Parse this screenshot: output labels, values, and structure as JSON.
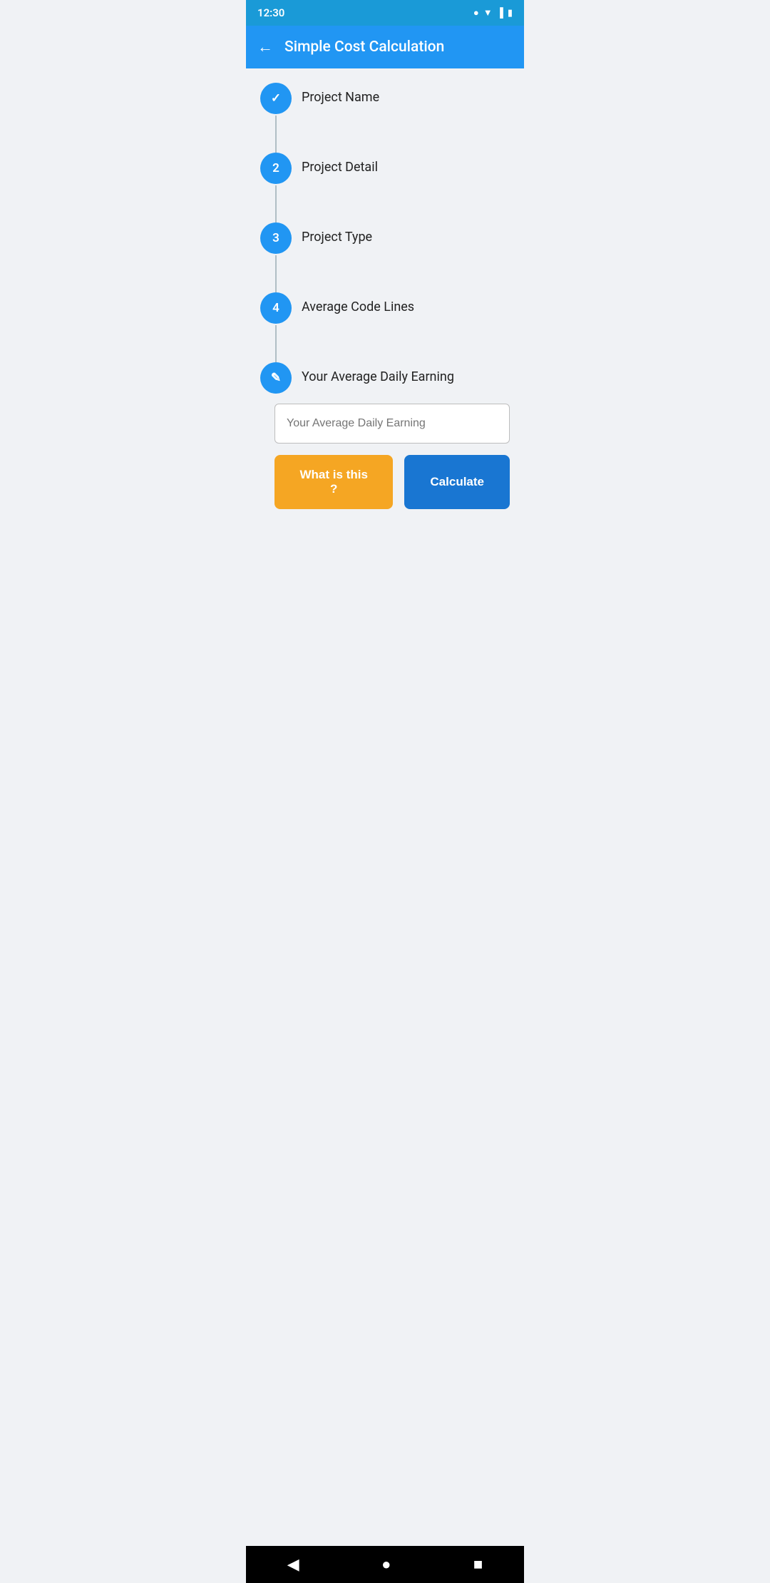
{
  "statusBar": {
    "time": "12:30",
    "icons": [
      "signal",
      "wifi",
      "battery"
    ]
  },
  "appBar": {
    "title": "Simple Cost Calculation",
    "backLabel": "←"
  },
  "steps": [
    {
      "id": "step-project-name",
      "number": "✓",
      "type": "completed",
      "label": "Project Name",
      "hasConnector": true
    },
    {
      "id": "step-project-detail",
      "number": "2",
      "type": "numbered",
      "label": "Project Detail",
      "hasConnector": true
    },
    {
      "id": "step-project-type",
      "number": "3",
      "type": "numbered",
      "label": "Project Type",
      "hasConnector": true
    },
    {
      "id": "step-average-code-lines",
      "number": "4",
      "type": "numbered",
      "label": "Average Code Lines",
      "hasConnector": true
    },
    {
      "id": "step-daily-earning",
      "number": "✎",
      "type": "edit",
      "label": "Your Average Daily Earning",
      "hasConnector": false
    }
  ],
  "input": {
    "placeholder": "Your Average Daily Earning"
  },
  "buttons": {
    "whatIsThis": "What is this ?",
    "calculate": "Calculate"
  },
  "navBar": {
    "back": "◀",
    "home": "●",
    "recent": "■"
  }
}
